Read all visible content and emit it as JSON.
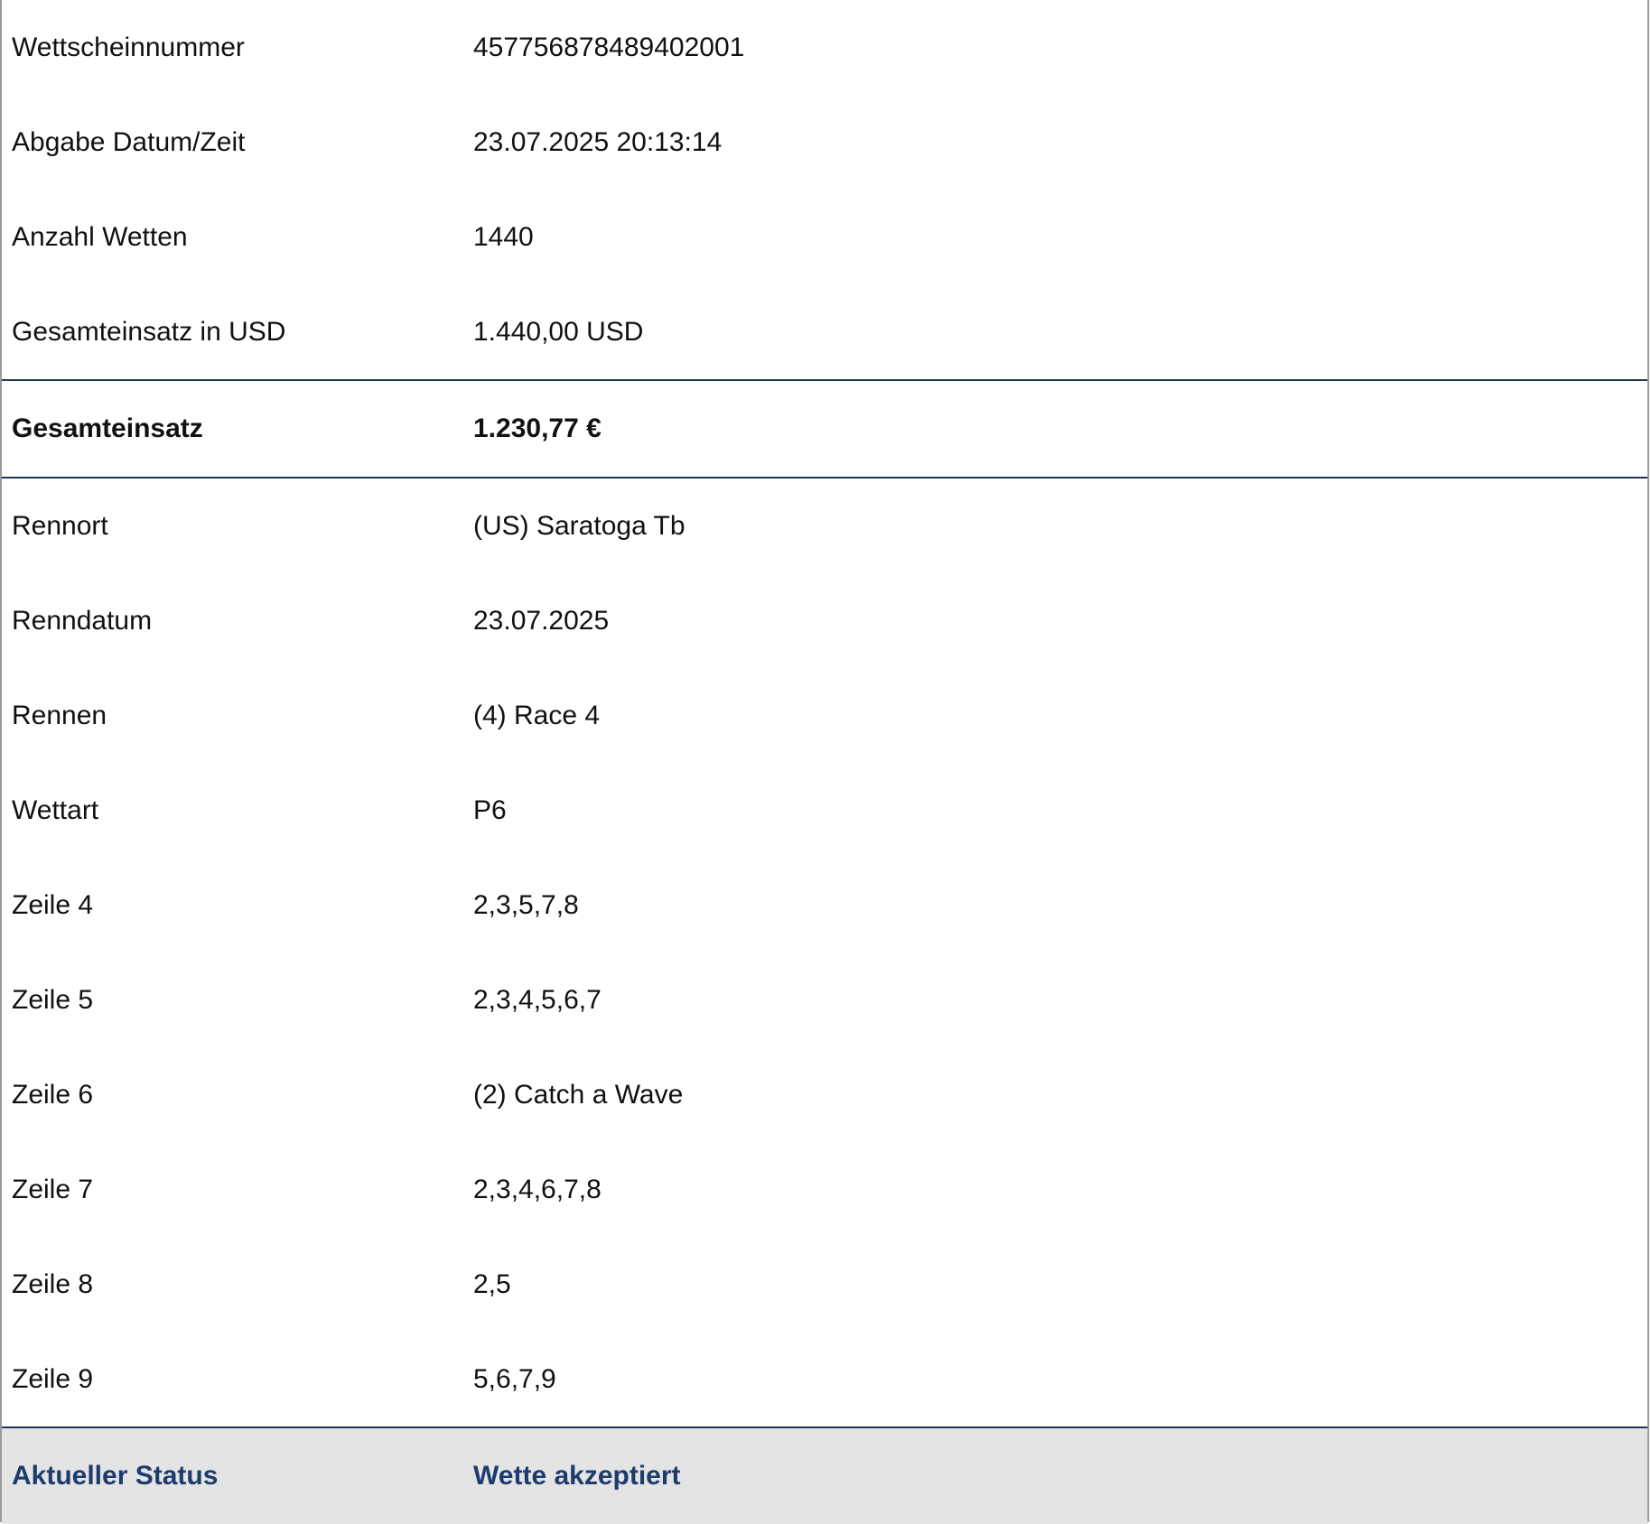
{
  "rows_top": [
    {
      "label": "Wettscheinnummer",
      "value": "457756878489402001"
    },
    {
      "label": "Abgabe Datum/Zeit",
      "value": "23.07.2025 20:13:14"
    },
    {
      "label": "Anzahl Wetten",
      "value": "1440"
    },
    {
      "label": "Gesamteinsatz in USD",
      "value": "1.440,00 USD"
    }
  ],
  "total": {
    "label": "Gesamteinsatz",
    "value": "1.230,77 €"
  },
  "rows_bottom": [
    {
      "label": "Rennort",
      "value": "(US) Saratoga Tb"
    },
    {
      "label": "Renndatum",
      "value": "23.07.2025"
    },
    {
      "label": "Rennen",
      "value": "(4) Race 4"
    },
    {
      "label": "Wettart",
      "value": "P6"
    },
    {
      "label": "Zeile 4",
      "value": "2,3,5,7,8"
    },
    {
      "label": "Zeile 5",
      "value": "2,3,4,5,6,7"
    },
    {
      "label": "Zeile 6",
      "value": "(2) Catch a Wave"
    },
    {
      "label": "Zeile 7",
      "value": "2,3,4,6,7,8"
    },
    {
      "label": "Zeile 8",
      "value": "2,5"
    },
    {
      "label": "Zeile 9",
      "value": "5,6,7,9"
    }
  ],
  "status": {
    "label": "Aktueller Status",
    "value": "Wette akzeptiert"
  },
  "colors": {
    "status_text": "#1d3c6e",
    "status_bg": "#e4e4e4",
    "divider": "#1d3557"
  }
}
